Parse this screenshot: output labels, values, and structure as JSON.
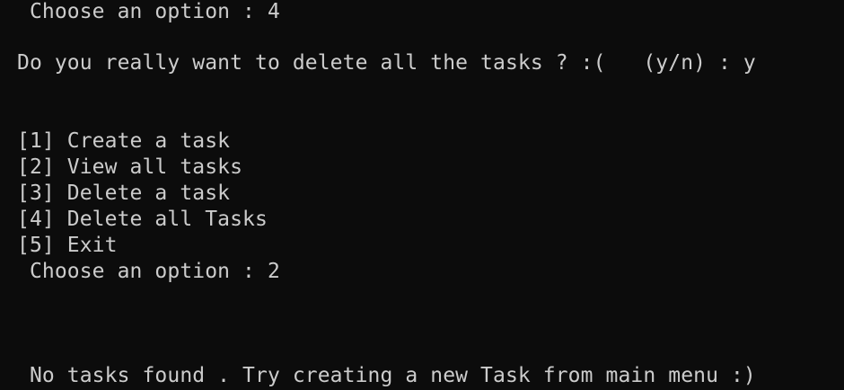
{
  "terminal": {
    "lines": [
      " Choose an option : 4",
      "Do you really want to delete all the tasks ? :(   (y/n) : y",
      "[1] Create a task",
      "[2] View all tasks",
      "[3] Delete a task",
      "[4] Delete all Tasks",
      "[5] Exit",
      " Choose an option : 2",
      " No tasks found . Try creating a new Task from main menu :)"
    ]
  },
  "colors": {
    "background": "#0c0c0c",
    "foreground": "#cccccc"
  }
}
